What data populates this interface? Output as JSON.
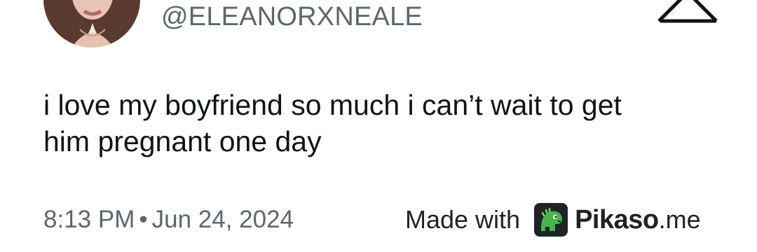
{
  "tweet": {
    "handle": "@ELEANORXNEALE",
    "line1": "i love my boyfriend so much i can’t wait to get",
    "line2": "him pregnant one day",
    "time": "8:13 PM",
    "separator": "•",
    "date": "Jun 24, 2024"
  },
  "watermark": {
    "made_with": "Made with",
    "brand": "Pikaso",
    "tld": ".me"
  },
  "icons": {
    "platform": "x-logo-icon",
    "watermark": "pikaso-dino-icon"
  },
  "colors": {
    "text": "#0f1419",
    "secondary": "#5b6670",
    "pikaso_green": "#43b649"
  }
}
